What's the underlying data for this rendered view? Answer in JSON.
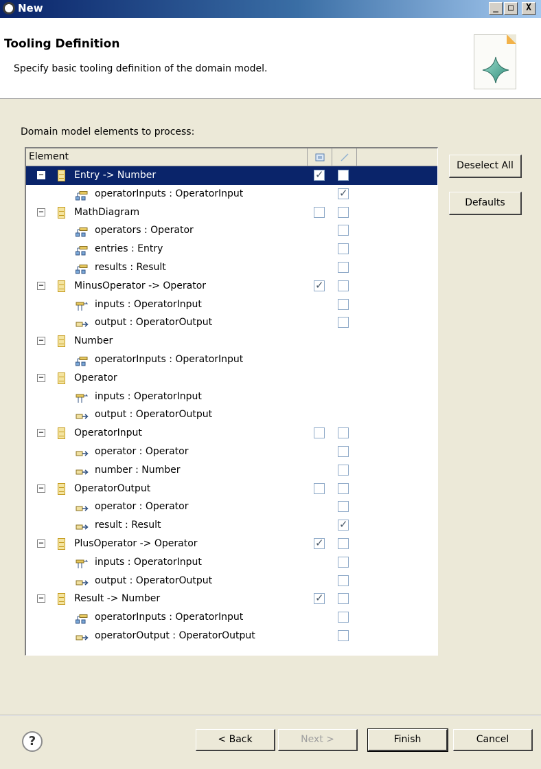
{
  "window": {
    "title": "New",
    "minimize_glyph": "_",
    "maximize_glyph": "□",
    "close_glyph": "X"
  },
  "header": {
    "title": "Tooling Definition",
    "description": "Specify basic tooling definition of the domain model."
  },
  "main": {
    "label": "Domain model elements to process:",
    "columns": [
      "Element",
      "node-icon",
      "link-icon"
    ],
    "rows": [
      {
        "kind": "class",
        "label": "Entry -> Number",
        "expander": "−",
        "c1": true,
        "c2": false,
        "selected": true
      },
      {
        "kind": "feature",
        "label": "operatorInputs : OperatorInput",
        "icon": "containment-reference-icon",
        "c2": true
      },
      {
        "kind": "class",
        "label": "MathDiagram",
        "expander": "−",
        "c1": false,
        "c2": false
      },
      {
        "kind": "feature",
        "label": "operators : Operator",
        "icon": "containment-reference-icon",
        "c2": false
      },
      {
        "kind": "feature",
        "label": "entries : Entry",
        "icon": "containment-reference-icon",
        "c2": false
      },
      {
        "kind": "feature",
        "label": "results : Result",
        "icon": "containment-reference-icon",
        "c2": false
      },
      {
        "kind": "class",
        "label": "MinusOperator -> Operator",
        "expander": "−",
        "c1": true,
        "c2": false
      },
      {
        "kind": "feature",
        "label": "inputs : OperatorInput",
        "icon": "multi-reference-icon",
        "c2": false
      },
      {
        "kind": "feature",
        "label": "output : OperatorOutput",
        "icon": "reference-icon",
        "c2": false
      },
      {
        "kind": "class",
        "label": "Number",
        "expander": "−"
      },
      {
        "kind": "feature",
        "label": "operatorInputs : OperatorInput",
        "icon": "containment-reference-icon"
      },
      {
        "kind": "class",
        "label": "Operator",
        "expander": "−"
      },
      {
        "kind": "feature",
        "label": "inputs : OperatorInput",
        "icon": "multi-reference-icon"
      },
      {
        "kind": "feature",
        "label": "output : OperatorOutput",
        "icon": "reference-icon"
      },
      {
        "kind": "class",
        "label": "OperatorInput",
        "expander": "−",
        "c1": false,
        "c2": false
      },
      {
        "kind": "feature",
        "label": "operator : Operator",
        "icon": "reference-icon",
        "c2": false
      },
      {
        "kind": "feature",
        "label": "number : Number",
        "icon": "reference-icon",
        "c2": false
      },
      {
        "kind": "class",
        "label": "OperatorOutput",
        "expander": "−",
        "c1": false,
        "c2": false
      },
      {
        "kind": "feature",
        "label": "operator : Operator",
        "icon": "reference-icon",
        "c2": false
      },
      {
        "kind": "feature",
        "label": "result : Result",
        "icon": "reference-icon",
        "c2": true
      },
      {
        "kind": "class",
        "label": "PlusOperator -> Operator",
        "expander": "−",
        "c1": true,
        "c2": false
      },
      {
        "kind": "feature",
        "label": "inputs : OperatorInput",
        "icon": "multi-reference-icon",
        "c2": false
      },
      {
        "kind": "feature",
        "label": "output : OperatorOutput",
        "icon": "reference-icon",
        "c2": false
      },
      {
        "kind": "class",
        "label": "Result -> Number",
        "expander": "−",
        "c1": true,
        "c2": false
      },
      {
        "kind": "feature",
        "label": "operatorInputs : OperatorInput",
        "icon": "containment-reference-icon",
        "c2": false
      },
      {
        "kind": "feature",
        "label": "operatorOutput : OperatorOutput",
        "icon": "reference-icon",
        "c2": false
      }
    ]
  },
  "side_buttons": {
    "deselect_all": "Deselect All",
    "defaults": "Defaults"
  },
  "footer": {
    "help": "?",
    "back": "< Back",
    "next": "Next >",
    "finish": "Finish",
    "cancel": "Cancel"
  },
  "colors": {
    "selection": "#0a246a",
    "dialog_bg": "#ece9d8",
    "title_gradient_start": "#0a246a",
    "title_gradient_end": "#a6caf0"
  }
}
